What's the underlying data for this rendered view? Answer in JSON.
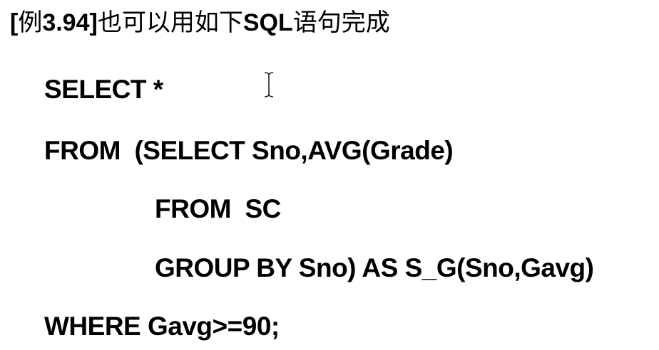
{
  "title": {
    "bracket_open": "[",
    "cn_example": "例",
    "number": "3.94",
    "bracket_close": "]",
    "cn_text1": "也可以用如下",
    "sql": "SQL",
    "cn_text2": "语句完成"
  },
  "code": {
    "line1": "SELECT *",
    "line2": "FROM  (SELECT Sno,AVG(Grade)",
    "line3": "FROM  SC",
    "line4": "GROUP BY Sno) AS S_G(Sno,Gavg)",
    "line5": "WHERE Gavg>=90;"
  },
  "cursor": {
    "icon": "text-cursor-icon"
  }
}
